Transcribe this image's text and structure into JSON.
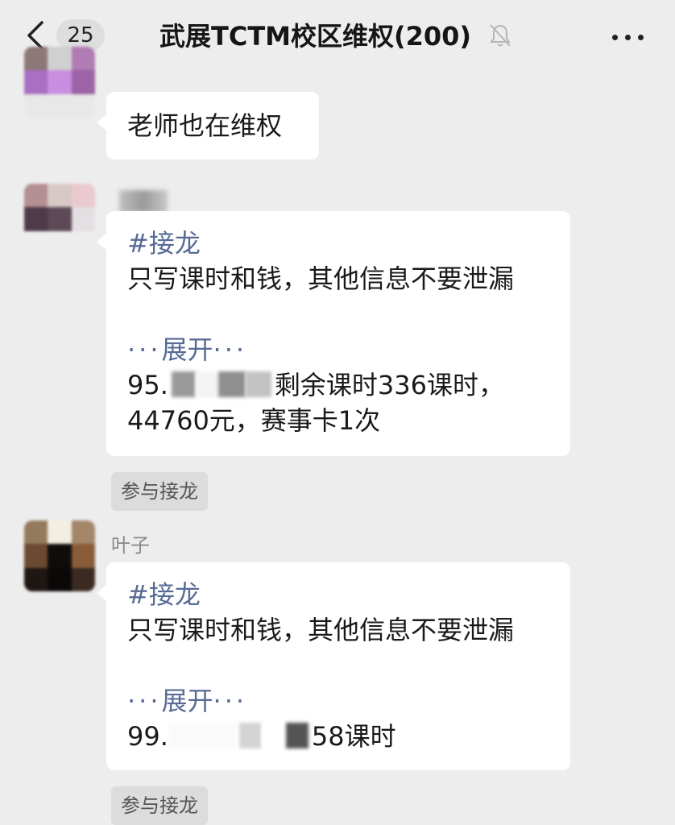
{
  "header": {
    "back_label": "back",
    "unread_count": "25",
    "title": "武展TCTM校区维权(200)",
    "mute_icon": "bell-mute-icon",
    "more_icon": "more-dots-icon"
  },
  "messages": [
    {
      "sender": "",
      "text": "老师也在维权"
    },
    {
      "sender": "",
      "tag": "#接龙",
      "line1": "只写课时和钱，其他信息不要泄漏",
      "expand_label": "展开",
      "entry_prefix": "95.",
      "entry_suffix": "剩余课时336课时，",
      "entry_line2": "44760元，赛事卡1次",
      "join_label": "参与接龙"
    },
    {
      "sender": "叶子",
      "tag": "#接龙",
      "line1": "只写课时和钱，其他信息不要泄漏",
      "expand_label": "展开",
      "entry_prefix": "99.",
      "entry_suffix": "58课时",
      "join_label": "参与接龙"
    }
  ],
  "colors": {
    "background": "#ededed",
    "bubble": "#ffffff",
    "link": "#576b95",
    "join_button": "#dcdcdc"
  }
}
